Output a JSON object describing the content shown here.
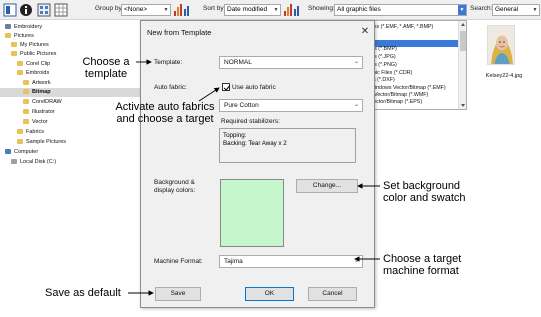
{
  "toolbar": {
    "group_by_label": "Group by:",
    "group_by_value": "<None>",
    "sort_by_label": "Sort by:",
    "sort_by_value": "Date modified",
    "showing_label": "Showing:",
    "showing_value": "All graphic files",
    "search_label": "Search:",
    "search_value": "General"
  },
  "tree": {
    "items": [
      {
        "label": "Embroidery",
        "icon": "embroidery-folder-icon"
      },
      {
        "label": "Pictures",
        "icon": "folder-icon"
      },
      {
        "label": "My Pictures",
        "icon": "folder-icon"
      },
      {
        "label": "Public Pictures",
        "icon": "folder-icon"
      },
      {
        "label": "Corel Clip",
        "icon": "folder-icon"
      },
      {
        "label": "Embroids",
        "icon": "folder-icon"
      },
      {
        "label": "Artwork",
        "icon": "folder-icon"
      },
      {
        "label": "Bitmap",
        "icon": "folder-icon",
        "selected": true
      },
      {
        "label": "CorelDRAW",
        "icon": "folder-icon"
      },
      {
        "label": "Illustrator",
        "icon": "folder-icon"
      },
      {
        "label": "Vector",
        "icon": "folder-icon"
      },
      {
        "label": "Fabrics",
        "icon": "folder-icon"
      },
      {
        "label": "Sample Pictures",
        "icon": "folder-icon"
      },
      {
        "label": "Computer",
        "icon": "computer-icon"
      },
      {
        "label": "Local Disk (C:)",
        "icon": "disk-icon"
      }
    ]
  },
  "filetypes": {
    "items": [
      "illes (*.EMF, *.AMF, *.BMP)",
      "les (*.BMP)",
      "les (*.JPG)",
      "les (*.PNG)",
      "phic Files (*.CDR)",
      "es (*.DXF)",
      "Windows Vector/Bitmap (*.EMF)",
      "s Vector/Bitmap (*.WMF)",
      "Vector/Bitmap (*.EPS)"
    ]
  },
  "thumbnail": {
    "caption": "Kelsey22-4.jpg"
  },
  "dialog": {
    "title": "New from Template",
    "template_label": "Template:",
    "template_value": "NORMAL",
    "auto_fabric_label": "Auto fabric:",
    "use_auto_fabric_label": "Use auto fabric",
    "use_auto_fabric_checked": true,
    "fabric_value": "Pure Cotton",
    "stabilizers_label": "Required stabilizers:",
    "stabilizers_lines": [
      "Topping:",
      "Backing: Tear Away x 2"
    ],
    "background_label_1": "Background &",
    "background_label_2": "display colors:",
    "swatch_color": "#c6f7cc",
    "change_button": "Change...",
    "machine_format_label": "Machine Format:",
    "machine_format_value": "Tajima",
    "save_button": "Save",
    "ok_button": "OK",
    "cancel_button": "Cancel"
  },
  "annotations": {
    "choose_template_1": "Choose a",
    "choose_template_2": "template",
    "auto_fabric_1": "Activate auto fabrics",
    "auto_fabric_2": "and choose a target",
    "background_1": "Set background",
    "background_2": "color and swatch",
    "machine_1": "Choose a target",
    "machine_2": "machine format",
    "save_default": "Save as default"
  }
}
